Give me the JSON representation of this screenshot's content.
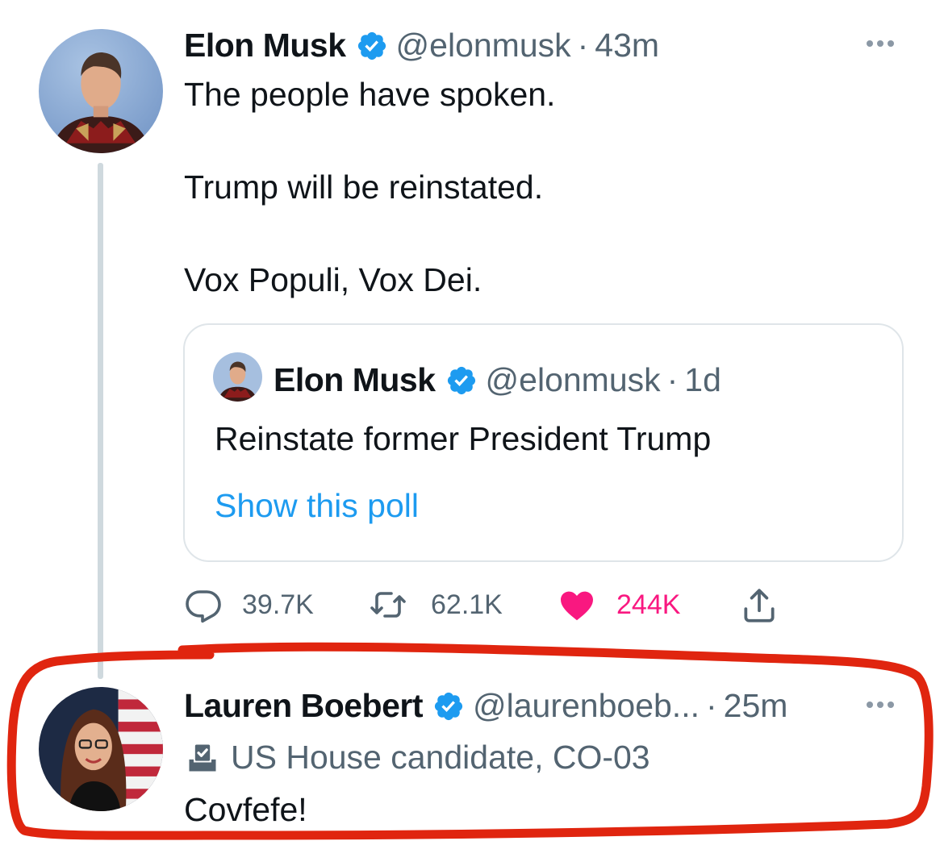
{
  "main_tweet": {
    "author_name": "Elon Musk",
    "handle": "@elonmusk",
    "separator": "·",
    "time": "43m",
    "text_lines": [
      "The people have spoken.",
      "Trump will be reinstated.",
      "Vox Populi, Vox Dei."
    ],
    "quote": {
      "author_name": "Elon Musk",
      "handle": "@elonmusk",
      "separator": "·",
      "time": "1d",
      "text": "Reinstate former President Trump",
      "link_label": "Show this poll"
    },
    "actions": {
      "replies": "39.7K",
      "retweets": "62.1K",
      "likes": "244K"
    },
    "icons": [
      "verified-badge-icon",
      "more-icon",
      "reply-icon",
      "retweet-icon",
      "heart-icon",
      "share-icon"
    ]
  },
  "reply_tweet": {
    "author_name": "Lauren Boebert",
    "handle": "@laurenboeb...",
    "separator": "·",
    "time": "25m",
    "label": "US House candidate, CO-03",
    "text": "Covfefe!",
    "icons": [
      "verified-badge-icon",
      "ballot-box-icon",
      "more-icon"
    ]
  },
  "colors": {
    "verified": "#1d9bf0",
    "link": "#1d9bf0",
    "like": "#f91880",
    "secondary_text": "#536471",
    "highlight": "#e0250f"
  }
}
